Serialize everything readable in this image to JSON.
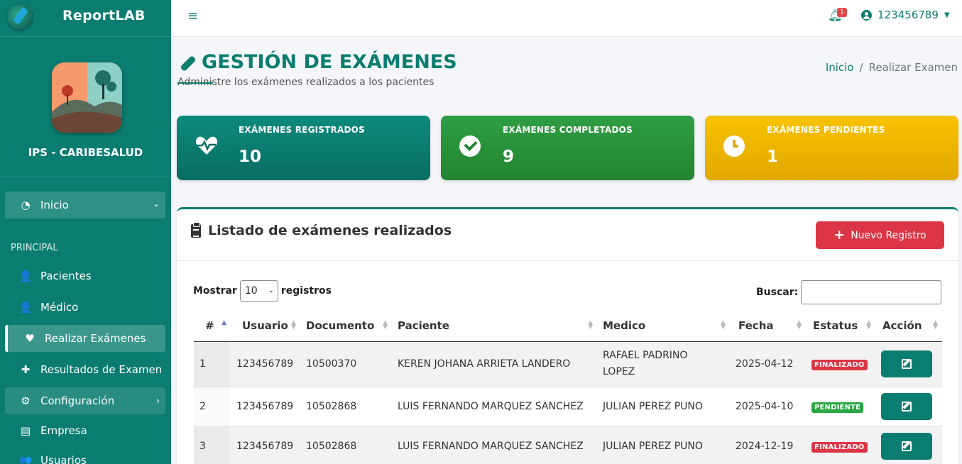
{
  "brand": {
    "name": "ReportLAB"
  },
  "org": {
    "name": "IPS - CARIBESALUD"
  },
  "sidebar": {
    "main_item": {
      "label": "Inicio"
    },
    "section_label": "PRINCIPAL",
    "items": [
      {
        "label": "Pacientes",
        "icon": "user-nurse-icon"
      },
      {
        "label": "Médico",
        "icon": "user-doctor-icon"
      },
      {
        "label": "Realizar Exámenes",
        "icon": "heart-pulse-icon"
      },
      {
        "label": "Resultados de Examen",
        "icon": "medkit-icon"
      },
      {
        "label": "Configuración",
        "icon": "gears-icon"
      },
      {
        "label": "Empresa",
        "icon": "id-card-icon"
      },
      {
        "label": "Usuarios",
        "icon": "users-icon"
      }
    ]
  },
  "topbar": {
    "notifications": "1",
    "user": "123456789"
  },
  "header": {
    "title": "GESTIÓN DE EXÁMENES",
    "subtitle": "Administre los exámenes realizados a los pacientes",
    "breadcrumb_home": "Inicio",
    "breadcrumb_current": "Realizar Examen"
  },
  "stats": [
    {
      "label": "EXÁMENES REGISTRADOS",
      "value": "10",
      "color": "#0b7d70"
    },
    {
      "label": "EXÁMENES COMPLETADOS",
      "value": "9",
      "color": "#28a745"
    },
    {
      "label": "EXÁMENES PENDIENTES",
      "value": "1",
      "color": "#f2b705"
    }
  ],
  "panel": {
    "title": "Listado de exámenes realizados",
    "new_button": "Nuevo Registro",
    "show_prefix": "Mostrar",
    "show_value": "10",
    "show_suffix": "registros",
    "search_label": "Buscar:",
    "search_value": ""
  },
  "table": {
    "headers": [
      "#",
      "Usuario",
      "Documento",
      "Paciente",
      "Medico",
      "Fecha",
      "Estatus",
      "Acción"
    ],
    "rows": [
      {
        "n": "1",
        "usuario": "123456789",
        "documento": "10500370",
        "paciente": "KEREN JOHANA ARRIETA LANDERO",
        "medico_1": "RAFAEL PADRINO",
        "medico_2": "LOPEZ",
        "fecha": "2025-04-12",
        "estatus": "FINALIZADO"
      },
      {
        "n": "2",
        "usuario": "123456789",
        "documento": "10502868",
        "paciente": "LUIS FERNANDO MARQUEZ SANCHEZ",
        "medico_1": "JULIAN PEREZ PUNO",
        "medico_2": "",
        "fecha": "2025-04-10",
        "estatus": "PENDIENTE"
      },
      {
        "n": "3",
        "usuario": "123456789",
        "documento": "10502868",
        "paciente": "LUIS FERNANDO MARQUEZ SANCHEZ",
        "medico_1": "JULIAN PEREZ PUNO",
        "medico_2": "",
        "fecha": "2024-12-19",
        "estatus": "FINALIZADO"
      }
    ]
  }
}
